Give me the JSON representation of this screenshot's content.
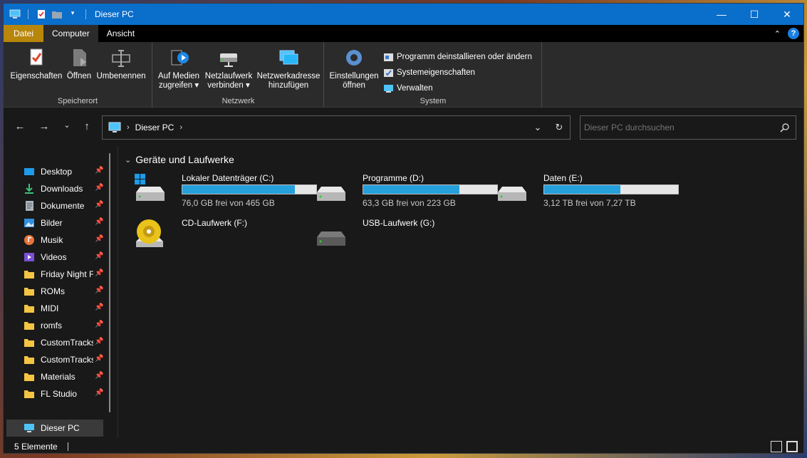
{
  "window": {
    "title": "Dieser PC",
    "accent": "#0a6ecb"
  },
  "tabs": {
    "file": "Datei",
    "computer": "Computer",
    "view": "Ansicht"
  },
  "ribbon": {
    "location": {
      "label": "Speicherort",
      "properties": "Eigenschaften",
      "open": "Öffnen",
      "rename": "Umbenennen"
    },
    "network": {
      "label": "Netzwerk",
      "media_line1": "Auf Medien",
      "media_line2": "zugreifen",
      "map_line1": "Netzlaufwerk",
      "map_line2": "verbinden",
      "add_line1": "Netzwerkadresse",
      "add_line2": "hinzufügen"
    },
    "system": {
      "label": "System",
      "settings_line1": "Einstellungen",
      "settings_line2": "öffnen",
      "uninstall": "Programm deinstallieren oder ändern",
      "sysprops": "Systemeigenschaften",
      "manage": "Verwalten"
    }
  },
  "address": {
    "crumb": "Dieser PC"
  },
  "search": {
    "placeholder": "Dieser PC durchsuchen"
  },
  "sidebar": {
    "items": [
      {
        "label": "Desktop",
        "icon": "desktop-icon",
        "pinned": true
      },
      {
        "label": "Downloads",
        "icon": "downloads-icon",
        "pinned": true
      },
      {
        "label": "Dokumente",
        "icon": "documents-icon",
        "pinned": true
      },
      {
        "label": "Bilder",
        "icon": "pictures-icon",
        "pinned": true
      },
      {
        "label": "Musik",
        "icon": "music-icon",
        "pinned": true
      },
      {
        "label": "Videos",
        "icon": "videos-icon",
        "pinned": true
      },
      {
        "label": "Friday Night Fu",
        "icon": "folder-icon",
        "pinned": true
      },
      {
        "label": "ROMs",
        "icon": "folder-icon",
        "pinned": true
      },
      {
        "label": "MIDI",
        "icon": "folder-icon",
        "pinned": true
      },
      {
        "label": "romfs",
        "icon": "folder-icon",
        "pinned": true
      },
      {
        "label": "CustomTracks'",
        "icon": "folder-icon",
        "pinned": true
      },
      {
        "label": "CustomTracksI",
        "icon": "folder-icon",
        "pinned": true
      },
      {
        "label": "Materials",
        "icon": "folder-icon",
        "pinned": true
      },
      {
        "label": "FL Studio",
        "icon": "folder-icon",
        "pinned": true
      }
    ],
    "this_pc": "Dieser PC"
  },
  "content": {
    "section_title": "Geräte und Laufwerke",
    "drives": [
      {
        "name": "Lokaler Datenträger (C:)",
        "free": "76,0 GB frei von 465 GB",
        "used_fraction": 0.84,
        "icon": "windows-drive-icon"
      },
      {
        "name": "Programme (D:)",
        "free": "63,3 GB frei von 223 GB",
        "used_fraction": 0.72,
        "icon": "hard-drive-icon"
      },
      {
        "name": "Daten (E:)",
        "free": "3,12 TB frei von 7,27 TB",
        "used_fraction": 0.57,
        "icon": "hard-drive-icon"
      },
      {
        "name": "CD-Laufwerk (F:)",
        "icon": "cd-drive-icon"
      },
      {
        "name": "USB-Laufwerk (G:)",
        "icon": "usb-drive-icon"
      }
    ]
  },
  "status": {
    "count": "5 Elemente"
  }
}
